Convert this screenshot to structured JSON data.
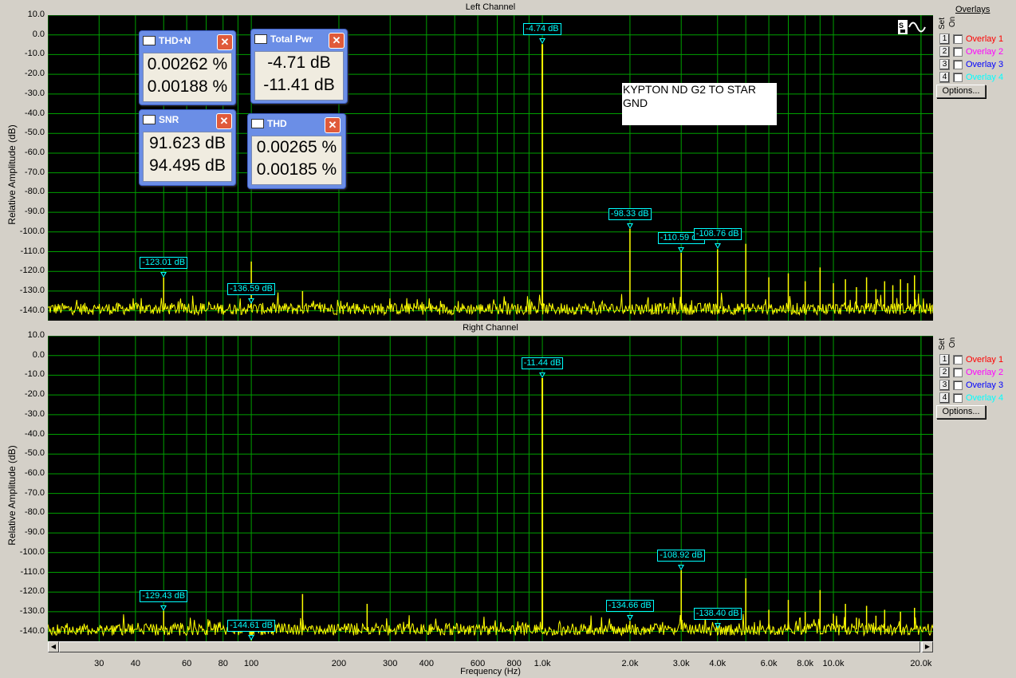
{
  "colors": {
    "plot_bg": "#000000",
    "grid": "#00a000",
    "trace": "#ffff00",
    "marker": "#00ffff",
    "window_bg": "#d4d0c8"
  },
  "top_panel": {
    "title": "Left Channel"
  },
  "bottom_panel": {
    "title": "Right Channel"
  },
  "y_axis_label": "Relative Amplitude (dB)",
  "x_axis_label": "Frequency (Hz)",
  "y_ticks": [
    "10.0",
    "0.0",
    "-10.0",
    "-20.0",
    "-30.0",
    "-40.0",
    "-50.0",
    "-60.0",
    "-70.0",
    "-80.0",
    "-90.0",
    "-100.0",
    "-110.0",
    "-120.0",
    "-130.0",
    "-140.0"
  ],
  "x_ticks": [
    {
      "label": "30",
      "hz": 30
    },
    {
      "label": "40",
      "hz": 40
    },
    {
      "label": "60",
      "hz": 60
    },
    {
      "label": "80",
      "hz": 80
    },
    {
      "label": "100",
      "hz": 100
    },
    {
      "label": "200",
      "hz": 200
    },
    {
      "label": "300",
      "hz": 300
    },
    {
      "label": "400",
      "hz": 400
    },
    {
      "label": "600",
      "hz": 600
    },
    {
      "label": "800",
      "hz": 800
    },
    {
      "label": "1.0k",
      "hz": 1000
    },
    {
      "label": "2.0k",
      "hz": 2000
    },
    {
      "label": "3.0k",
      "hz": 3000
    },
    {
      "label": "4.0k",
      "hz": 4000
    },
    {
      "label": "6.0k",
      "hz": 6000
    },
    {
      "label": "8.0k",
      "hz": 8000
    },
    {
      "label": "10.0k",
      "hz": 10000
    },
    {
      "label": "20.0k",
      "hz": 20000
    }
  ],
  "overlays": {
    "header": "Overlays",
    "set_label": "Set",
    "on_label": "On",
    "items": [
      {
        "num": "1",
        "label": "Overlay 1",
        "color": "#ff0000"
      },
      {
        "num": "2",
        "label": "Overlay 2",
        "color": "#ff00ff"
      },
      {
        "num": "3",
        "label": "Overlay 3",
        "color": "#0000ff"
      },
      {
        "num": "4",
        "label": "Overlay 4",
        "color": "#00ffff"
      }
    ],
    "options_label": "Options..."
  },
  "note_text": "KYPTON ND G2 TO STAR GND",
  "meters": {
    "thdn": {
      "title": "THD+N",
      "value_left": "0.00262 %",
      "value_right": "0.00188 %"
    },
    "total_pwr": {
      "title": "Total Pwr",
      "value_left": "-4.71 dB",
      "value_right": "-11.41 dB"
    },
    "snr": {
      "title": "SNR",
      "value_left": "91.623 dB",
      "value_right": "94.495 dB"
    },
    "thd": {
      "title": "THD",
      "value_left": "0.00265 %",
      "value_right": "0.00185 %"
    }
  },
  "chart_data": [
    {
      "type": "line",
      "title": "Left Channel",
      "xlabel": "Frequency (Hz)",
      "ylabel": "Relative Amplitude (dB)",
      "x_scale": "log",
      "xlim": [
        20,
        22000
      ],
      "ylim": [
        -145,
        10
      ],
      "grid": true,
      "noise_floor_db": -139,
      "peaks": [
        {
          "hz": 50,
          "db": -123.01
        },
        {
          "hz": 100,
          "db": -136.59
        },
        {
          "hz": 100,
          "db": -115
        },
        {
          "hz": 150,
          "db": -130
        },
        {
          "hz": 1000,
          "db": -4.74
        },
        {
          "hz": 2000,
          "db": -98.33
        },
        {
          "hz": 3000,
          "db": -110.59
        },
        {
          "hz": 4000,
          "db": -108.76
        },
        {
          "hz": 5000,
          "db": -106
        },
        {
          "hz": 6000,
          "db": -123
        },
        {
          "hz": 7000,
          "db": -121
        },
        {
          "hz": 8000,
          "db": -125
        },
        {
          "hz": 9000,
          "db": -118
        },
        {
          "hz": 10000,
          "db": -126
        },
        {
          "hz": 11000,
          "db": -124
        },
        {
          "hz": 12000,
          "db": -128
        },
        {
          "hz": 13000,
          "db": -123
        },
        {
          "hz": 14000,
          "db": -129
        },
        {
          "hz": 15000,
          "db": -125
        },
        {
          "hz": 16000,
          "db": -127
        },
        {
          "hz": 17000,
          "db": -124
        },
        {
          "hz": 18000,
          "db": -126
        },
        {
          "hz": 19000,
          "db": -122
        }
      ],
      "markers": [
        {
          "label": "-4.74 dB",
          "hz": 1000,
          "db": -4.74
        },
        {
          "label": "-98.33 dB",
          "hz": 2000,
          "db": -98.33
        },
        {
          "label": "-110.59 dB",
          "hz": 3000,
          "db": -110.59
        },
        {
          "label": "-108.76 dB",
          "hz": 4000,
          "db": -108.76
        },
        {
          "label": "-123.01 dB",
          "hz": 50,
          "db": -123.01
        },
        {
          "label": "-136.59 dB",
          "hz": 100,
          "db": -136.59
        }
      ]
    },
    {
      "type": "line",
      "title": "Right Channel",
      "xlabel": "Frequency (Hz)",
      "ylabel": "Relative Amplitude (dB)",
      "x_scale": "log",
      "xlim": [
        20,
        22000
      ],
      "ylim": [
        -145,
        10
      ],
      "grid": true,
      "noise_floor_db": -139,
      "peaks": [
        {
          "hz": 50,
          "db": -129.43
        },
        {
          "hz": 100,
          "db": -144.61
        },
        {
          "hz": 150,
          "db": -121
        },
        {
          "hz": 250,
          "db": -126
        },
        {
          "hz": 1000,
          "db": -11.44
        },
        {
          "hz": 2000,
          "db": -134.66
        },
        {
          "hz": 3000,
          "db": -108.92
        },
        {
          "hz": 4000,
          "db": -138.4
        },
        {
          "hz": 5000,
          "db": -113
        },
        {
          "hz": 6000,
          "db": -129
        },
        {
          "hz": 7000,
          "db": -124
        },
        {
          "hz": 8000,
          "db": -130
        },
        {
          "hz": 9000,
          "db": -119
        },
        {
          "hz": 10000,
          "db": -131
        },
        {
          "hz": 11000,
          "db": -126
        },
        {
          "hz": 12000,
          "db": -133
        },
        {
          "hz": 13000,
          "db": -127
        },
        {
          "hz": 14000,
          "db": -132
        },
        {
          "hz": 15000,
          "db": -129
        },
        {
          "hz": 17000,
          "db": -130
        },
        {
          "hz": 19000,
          "db": -128
        }
      ],
      "markers": [
        {
          "label": "-11.44 dB",
          "hz": 1000,
          "db": -11.44
        },
        {
          "label": "-108.92 dB",
          "hz": 3000,
          "db": -108.92
        },
        {
          "label": "-134.66 dB",
          "hz": 2000,
          "db": -134.66
        },
        {
          "label": "-138.40 dB",
          "hz": 4000,
          "db": -138.4
        },
        {
          "label": "-129.43 dB",
          "hz": 50,
          "db": -129.43
        },
        {
          "label": "-144.61 dB",
          "hz": 100,
          "db": -144.61
        }
      ]
    }
  ]
}
